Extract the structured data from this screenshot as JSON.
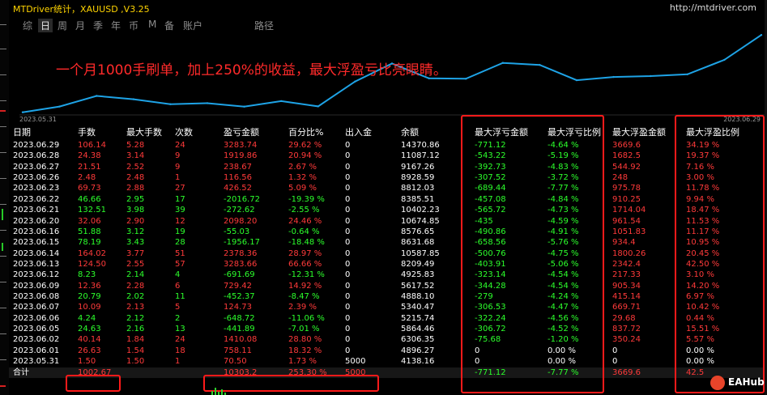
{
  "window": {
    "title": "MTDriver统计，XAUUSD ,V3.25",
    "url": "http://mtdriver.com"
  },
  "tabs": [
    "综",
    "日",
    "周",
    "月",
    "季",
    "年",
    "币",
    "M",
    "备",
    "账户",
    "路径"
  ],
  "active_tab": "日",
  "chart": {
    "caption": "一个月1000手刷单，加上250%的收益，最大浮盈亏比亮眼睛。",
    "date_start": "2023.05.31",
    "date_end": "2023.06.29",
    "line_color": "#1ea3e6"
  },
  "chart_data": {
    "type": "line",
    "title": "",
    "x": [
      "2023.05.31",
      "2023.06.01",
      "2023.06.02",
      "2023.06.05",
      "2023.06.06",
      "2023.06.07",
      "2023.06.08",
      "2023.06.09",
      "2023.06.12",
      "2023.06.13",
      "2023.06.14",
      "2023.06.15",
      "2023.06.16",
      "2023.06.20",
      "2023.06.21",
      "2023.06.22",
      "2023.06.23",
      "2023.06.26",
      "2023.06.27",
      "2023.06.28",
      "2023.06.29"
    ],
    "series": [
      {
        "values": [
          4138.16,
          4896.27,
          6306.35,
          5864.46,
          5215.74,
          5340.47,
          4888.1,
          5617.52,
          4925.83,
          8209.49,
          10587.85,
          8631.68,
          8576.65,
          10674.85,
          10402.23,
          8385.51,
          8812.03,
          8928.59,
          9167.26,
          11087.12,
          14370.86
        ]
      }
    ],
    "ylim": [
      4000,
      14500
    ]
  },
  "table": {
    "headers": [
      "日期",
      "手数",
      "最大手数",
      "次数",
      "盈亏金额",
      "百分比%",
      "出入金",
      "余额",
      "最大浮亏金额",
      "最大浮亏比例",
      "最大浮盈金额",
      "最大浮盈比例"
    ],
    "rows": [
      [
        "2023.06.29",
        "106.14",
        "5.28",
        "24",
        "3283.74",
        "29.62 %",
        "0",
        "14370.86",
        "-771.12",
        "-4.64 %",
        "3669.6",
        "34.19 %"
      ],
      [
        "2023.06.28",
        "24.38",
        "3.14",
        "9",
        "1919.86",
        "20.94 %",
        "0",
        "11087.12",
        "-543.22",
        "-5.19 %",
        "1682.5",
        "19.37 %"
      ],
      [
        "2023.06.27",
        "21.51",
        "2.52",
        "9",
        "238.67",
        "2.67 %",
        "0",
        "9167.26",
        "-392.73",
        "-4.83 %",
        "544.92",
        "7.16 %"
      ],
      [
        "2023.06.26",
        "2.48",
        "2.48",
        "1",
        "116.56",
        "1.32 %",
        "0",
        "8928.59",
        "-307.52",
        "-3.72 %",
        "248",
        "3.00 %"
      ],
      [
        "2023.06.23",
        "69.73",
        "2.88",
        "27",
        "426.52",
        "5.09 %",
        "0",
        "8812.03",
        "-689.44",
        "-7.77 %",
        "975.78",
        "11.78 %"
      ],
      [
        "2023.06.22",
        "46.66",
        "2.95",
        "17",
        "-2016.72",
        "-19.39 %",
        "0",
        "8385.51",
        "-457.08",
        "-4.84 %",
        "910.25",
        "9.94 %"
      ],
      [
        "2023.06.21",
        "132.51",
        "3.98",
        "39",
        "-272.62",
        "-2.55 %",
        "0",
        "10402.23",
        "-565.72",
        "-4.73 %",
        "1714.04",
        "18.47 %"
      ],
      [
        "2023.06.20",
        "32.06",
        "2.90",
        "12",
        "2098.20",
        "24.46 %",
        "0",
        "10674.85",
        "-435",
        "-4.59 %",
        "961.54",
        "11.53 %"
      ],
      [
        "2023.06.16",
        "51.88",
        "3.12",
        "19",
        "-55.03",
        "-0.64 %",
        "0",
        "8576.65",
        "-490.86",
        "-4.91 %",
        "1051.83",
        "11.17 %"
      ],
      [
        "2023.06.15",
        "78.19",
        "3.43",
        "28",
        "-1956.17",
        "-18.48 %",
        "0",
        "8631.68",
        "-658.56",
        "-5.76 %",
        "934.4",
        "10.95 %"
      ],
      [
        "2023.06.14",
        "164.02",
        "3.77",
        "51",
        "2378.36",
        "28.97 %",
        "0",
        "10587.85",
        "-500.76",
        "-4.75 %",
        "1800.26",
        "20.45 %"
      ],
      [
        "2023.06.13",
        "124.50",
        "2.55",
        "57",
        "3283.66",
        "66.66 %",
        "0",
        "8209.49",
        "-403.91",
        "-5.06 %",
        "2342.4",
        "42.50 %"
      ],
      [
        "2023.06.12",
        "8.23",
        "2.14",
        "4",
        "-691.69",
        "-12.31 %",
        "0",
        "4925.83",
        "-323.14",
        "-4.54 %",
        "217.33",
        "3.10 %"
      ],
      [
        "2023.06.09",
        "12.36",
        "2.28",
        "6",
        "729.42",
        "14.92 %",
        "0",
        "5617.52",
        "-344.28",
        "-4.54 %",
        "905.34",
        "14.20 %"
      ],
      [
        "2023.06.08",
        "20.79",
        "2.02",
        "11",
        "-452.37",
        "-8.47 %",
        "0",
        "4888.10",
        "-279",
        "-4.24 %",
        "415.14",
        "6.97 %"
      ],
      [
        "2023.06.07",
        "10.09",
        "2.13",
        "5",
        "124.73",
        "2.39 %",
        "0",
        "5340.47",
        "-306.53",
        "-4.47 %",
        "669.71",
        "10.42 %"
      ],
      [
        "2023.06.06",
        "4.24",
        "2.12",
        "2",
        "-648.72",
        "-11.06 %",
        "0",
        "5215.74",
        "-322.24",
        "-4.56 %",
        "29.68",
        "0.44 %"
      ],
      [
        "2023.06.05",
        "24.63",
        "2.16",
        "13",
        "-441.89",
        "-7.01 %",
        "0",
        "5864.46",
        "-306.72",
        "-4.52 %",
        "837.72",
        "15.51 %"
      ],
      [
        "2023.06.02",
        "40.14",
        "1.84",
        "24",
        "1410.08",
        "28.80 %",
        "0",
        "6306.35",
        "-75.68",
        "-1.20 %",
        "350.24",
        "5.57 %"
      ],
      [
        "2023.06.01",
        "26.63",
        "1.54",
        "18",
        "758.11",
        "18.32 %",
        "0",
        "4896.27",
        "0",
        "0.00 %",
        "0",
        "0.00 %"
      ],
      [
        "2023.05.31",
        "1.50",
        "1.50",
        "1",
        "70.50",
        "1.73 %",
        "5000",
        "4138.16",
        "0",
        "0.00 %",
        "0",
        "0.00 %"
      ]
    ],
    "row_colors": [
      "red",
      "red",
      "red",
      "red",
      "red",
      "grn",
      "grn",
      "red",
      "grn",
      "grn",
      "red",
      "red",
      "grn",
      "red",
      "grn",
      "red",
      "grn",
      "grn",
      "red",
      "red",
      "red"
    ],
    "total": {
      "label": "合计",
      "lots": "1002.67",
      "pnl": "10303.2",
      "pct": "253.30 %",
      "flow": "5000",
      "dd": "-771.12",
      "ddp": "-7.77 %",
      "fp": "3669.6",
      "fpp": "42.5"
    }
  },
  "watermark": {
    "brand": "EAHub"
  },
  "colors": {
    "positive": "#ff3a3a",
    "negative": "#2cff2c",
    "highlight_box": "#ff1a1a",
    "title": "#ffd400"
  }
}
